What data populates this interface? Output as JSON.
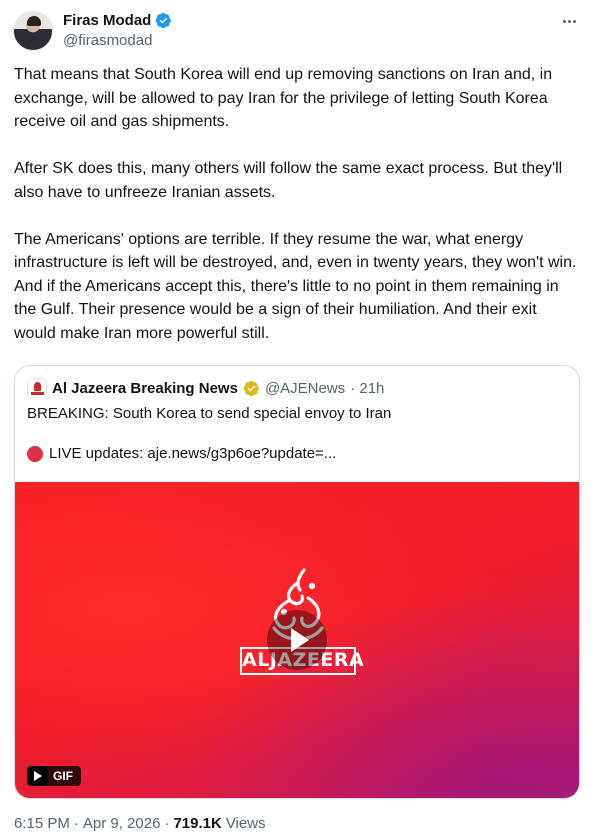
{
  "author": {
    "name": "Firas Modad",
    "handle": "@firasmodad",
    "verified_color": "#1d9bf0"
  },
  "tweet": {
    "paragraphs": [
      "That means that South Korea will end up removing sanctions on Iran and, in exchange, will be allowed to pay Iran for the privilege of letting South Korea receive oil and gas shipments.",
      "After SK does this, many others will follow the same exact process. But they'll also have to unfreeze Iranian assets.",
      "The Americans' options are terrible. If they resume the war, what energy infrastructure is left will be destroyed, and, even in twenty years, they won't win. And if the Americans accept this, there's little to no point in them remaining in the Gulf. Their presence would be a sign of their humiliation. And their exit would make Iran more powerful still."
    ]
  },
  "quote": {
    "name": "Al Jazeera Breaking News",
    "handle": "@AJENews",
    "time": "· 21h",
    "verified_color": "#e2b719",
    "line1": "BREAKING: South Korea to send special envoy to Iran",
    "line2": "LIVE updates: aje.news/g3p6oe?update=...",
    "media": {
      "logo_text": "ALJAZEERA",
      "badge": "GIF"
    }
  },
  "meta": {
    "time": "6:15 PM",
    "sep1": "·",
    "date": "Apr 9, 2026",
    "sep2": "·",
    "views_count": "719.1K",
    "views_label": "Views"
  },
  "icons": [
    "verified-badge-icon",
    "more-icon",
    "red-circle-icon",
    "play-icon",
    "gif-play-icon"
  ]
}
